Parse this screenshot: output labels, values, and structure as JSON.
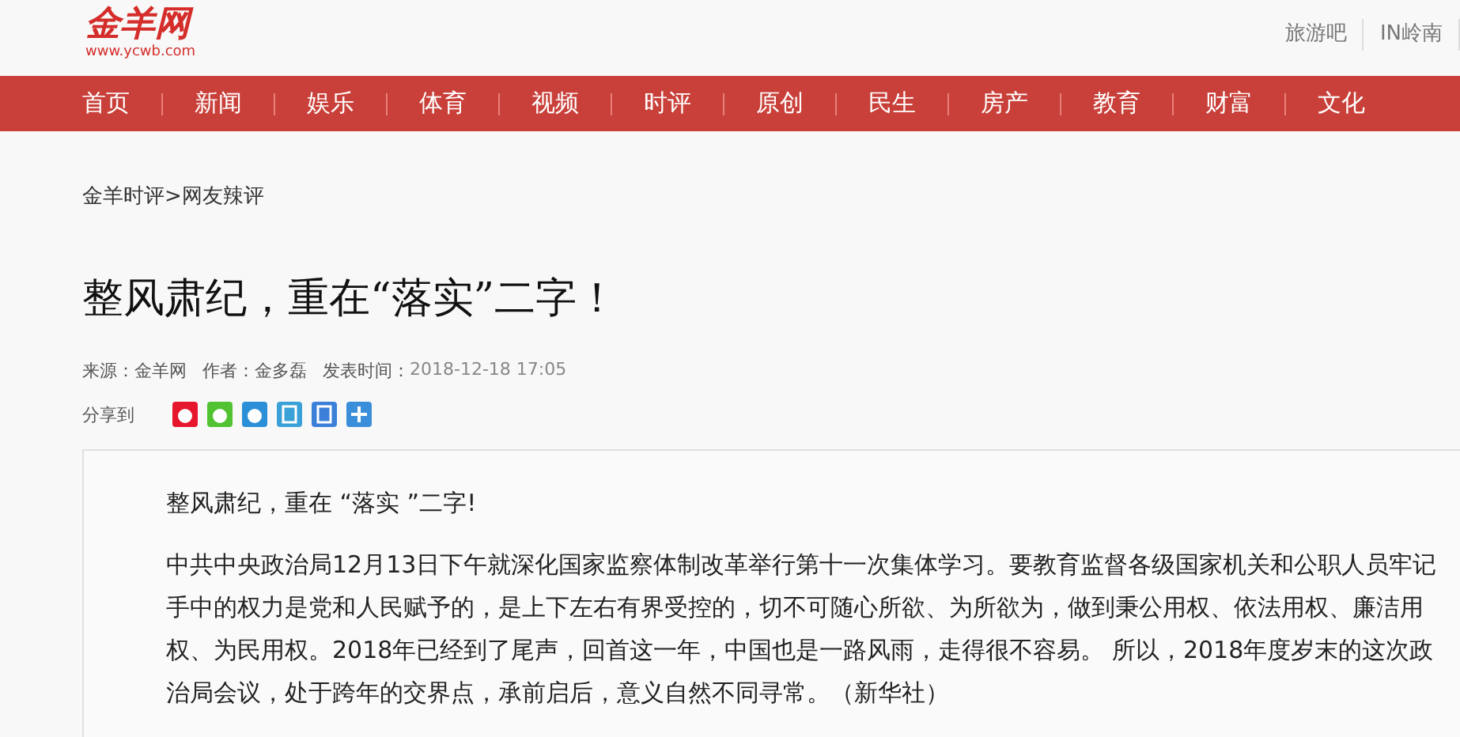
{
  "logo": {
    "name": "金羊网",
    "url": "www.ycwb.com"
  },
  "top_links": [
    "旅游吧",
    "IN岭南"
  ],
  "nav": [
    "首页",
    "新闻",
    "娱乐",
    "体育",
    "视频",
    "时评",
    "原创",
    "民生",
    "房产",
    "教育",
    "财富",
    "文化"
  ],
  "breadcrumb": "金羊时评>网友辣评",
  "article": {
    "title": "整风肃纪，重在“落实”二字！",
    "meta": [
      {
        "kind": "label",
        "text": "来源：金羊网"
      },
      {
        "kind": "label",
        "text": "作者：金多磊"
      },
      {
        "kind": "label",
        "text": "发表时间："
      },
      {
        "kind": "time",
        "text": "2018-12-18 17:05"
      }
    ],
    "share_label": "分享到",
    "share_icons": [
      {
        "kind": "weibo"
      },
      {
        "kind": "wechat"
      },
      {
        "kind": "qq"
      },
      {
        "kind": "huaban"
      },
      {
        "kind": "tieba"
      },
      {
        "kind": "more"
      }
    ],
    "paragraphs": [
      "整风肃纪，重在 “落实 ”二字!",
      "中共中央政治局12月13日下午就深化国家监察体制改革举行第十一次集体学习。要教育监督各级国家机关和公职人员牢记手中的权力是党和人民赋予的，是上下左右有界受控的，切不可随心所欲、为所欲为，做到秉公用权、依法用权、廉洁用权、为民用权。2018年已经到了尾声，回首这一年，中国也是一路风雨，走得很不容易。 所以，2018年度岁末的这次政治局会议，处于跨年的交界点，承前启后，意义自然不同寻常。（新华社）"
    ]
  }
}
